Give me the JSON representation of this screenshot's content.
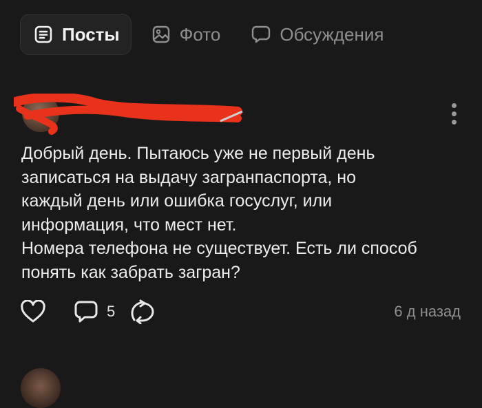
{
  "tabs": [
    {
      "label": "Посты",
      "icon": "document-list-icon",
      "active": true
    },
    {
      "label": "Фото",
      "icon": "image-icon",
      "active": false
    },
    {
      "label": "Обсуждения",
      "icon": "chat-bubble-icon",
      "active": false
    }
  ],
  "post": {
    "author_redacted": true,
    "text": "Добрый день. Пытаюсь уже не первый день\nзаписаться на выдачу загранпаспорта, но\nкаждый день или ошибка госуслуг, или\nинформация, что мест нет.\nНомера телефона не существует. Есть ли способ\nпонять как забрать загран?",
    "comments_count": "5",
    "time": "6 д назад"
  },
  "colors": {
    "background": "#191919",
    "tab_active_bg": "#232323",
    "redaction": "#e8321c",
    "muted_text": "#8f8f8f"
  }
}
